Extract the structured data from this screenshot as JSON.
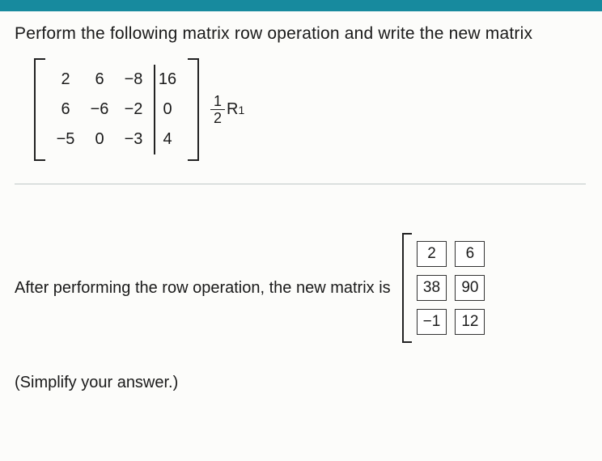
{
  "instruction": "Perform the following matrix row operation and write the new matrix",
  "matrix": {
    "rows": [
      [
        "2",
        "6",
        "−8",
        "16"
      ],
      [
        "6",
        "−6",
        "−2",
        "0"
      ],
      [
        "−5",
        "0",
        "−3",
        "4"
      ]
    ]
  },
  "operation": {
    "frac_n": "1",
    "frac_d": "2",
    "row_label": "R",
    "row_sub": "1"
  },
  "answer_text": "After performing the row operation, the new matrix is",
  "answer_matrix": {
    "rows": [
      [
        "2",
        "6"
      ],
      [
        "38",
        "90"
      ],
      [
        "−1",
        "12"
      ]
    ]
  },
  "simplify": "(Simplify your answer.)"
}
